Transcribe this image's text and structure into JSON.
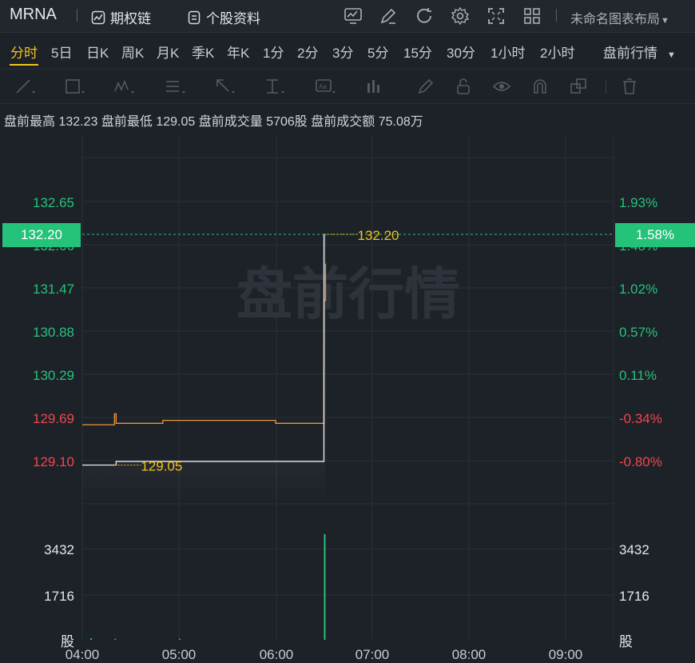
{
  "header": {
    "ticker": "MRNA",
    "options_chain": "期权链",
    "stock_profile": "个股资料",
    "layout_name": "未命名图表布局"
  },
  "periods": {
    "items": [
      "分时",
      "5日",
      "日K",
      "周K",
      "月K",
      "季K",
      "年K",
      "1分",
      "2分",
      "3分",
      "5分",
      "15分",
      "30分",
      "1小时",
      "2小时"
    ],
    "active": "分时",
    "session": "盘前行情"
  },
  "stats": {
    "high_label": "盘前最高",
    "high": "132.23",
    "low_label": "盘前最低",
    "low": "129.05",
    "vol_label": "盘前成交量",
    "vol": "5706股",
    "amt_label": "盘前成交额",
    "amt": "75.08万"
  },
  "watermark": "盘前行情",
  "price_axis": {
    "left": [
      {
        "v": "132.65",
        "c": "#25c27a"
      },
      {
        "v": "132.06",
        "c": "#25c27a"
      },
      {
        "v": "131.47",
        "c": "#25c27a"
      },
      {
        "v": "130.88",
        "c": "#25c27a"
      },
      {
        "v": "130.29",
        "c": "#25c27a"
      },
      {
        "v": "129.69",
        "c": "#f0474c"
      },
      {
        "v": "129.10",
        "c": "#f0474c"
      }
    ],
    "right": [
      {
        "v": "1.93%",
        "c": "#25c27a"
      },
      {
        "v": "1.48%",
        "c": "#25c27a"
      },
      {
        "v": "1.02%",
        "c": "#25c27a"
      },
      {
        "v": "0.57%",
        "c": "#25c27a"
      },
      {
        "v": "0.11%",
        "c": "#25c27a"
      },
      {
        "v": "-0.34%",
        "c": "#f0474c"
      },
      {
        "v": "-0.80%",
        "c": "#f0474c"
      }
    ]
  },
  "current": {
    "price": "132.20",
    "pct": "1.58%"
  },
  "markers": {
    "high": "132.20",
    "low": "129.05"
  },
  "volume_axis": {
    "ticks": [
      "3432",
      "1716"
    ],
    "unit": "股"
  },
  "time_axis": [
    "04:00",
    "05:00",
    "06:00",
    "07:00",
    "08:00",
    "09:00"
  ],
  "chart_data": {
    "type": "line",
    "title": "",
    "x": [
      "04:00",
      "04:20",
      "04:21",
      "04:50",
      "06:00",
      "06:29",
      "06:30",
      "06:31"
    ],
    "series": [
      {
        "name": "",
        "values": [
          129.05,
          129.05,
          129.1,
          129.1,
          129.1,
          129.1,
          132.2,
          132.2
        ]
      },
      {
        "name": "",
        "values": [
          129.6,
          129.75,
          129.62,
          129.66,
          129.62,
          129.62,
          131.3,
          131.8
        ]
      }
    ],
    "ylim": [
      128.9,
      133.1
    ],
    "volume": {
      "x": [
        "04:05",
        "04:20",
        "05:00",
        "06:30"
      ],
      "values": [
        60,
        40,
        40,
        4000
      ]
    }
  }
}
